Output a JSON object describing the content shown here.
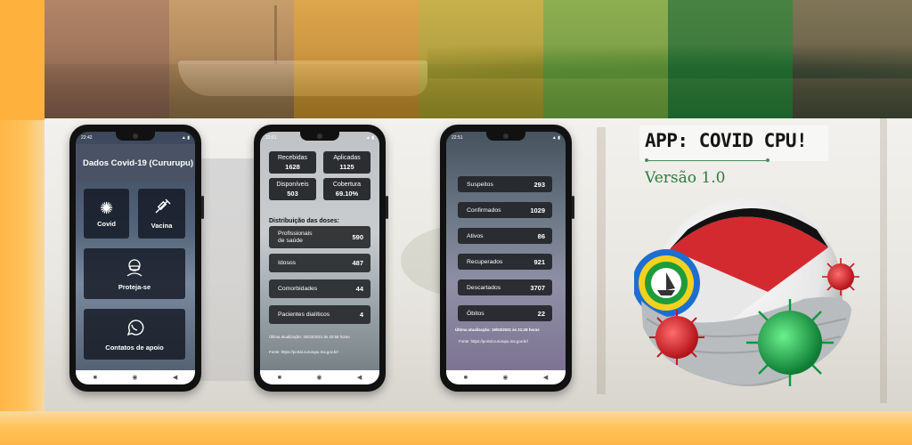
{
  "banner": {
    "colors": [
      "#a06e5a",
      "#c8965a",
      "#f0aa28",
      "#c8be28",
      "#6eb43c",
      "#1e7832",
      "#46503c"
    ]
  },
  "title": {
    "app_name": "APP: COVID CPU!",
    "version": "Versão 1.0"
  },
  "phone1": {
    "status_time": "22:42",
    "header": "Dados Covid-19 (Cururupu)",
    "cards": [
      {
        "label": "Covid",
        "icon": "virus-icon"
      },
      {
        "label": "Vacina",
        "icon": "syringe-icon"
      },
      {
        "label": "Proteja-se",
        "icon": "masked-face-icon"
      },
      {
        "label": "Contatos de apoio",
        "icon": "whatsapp-icon"
      }
    ]
  },
  "phone2": {
    "status_time": "22:51",
    "stats": [
      {
        "label": "Recebidas",
        "value": "1628"
      },
      {
        "label": "Aplicadas",
        "value": "1125"
      },
      {
        "label": "Disponíveis",
        "value": "503"
      },
      {
        "label": "Cobertura",
        "value": "69.10%"
      }
    ],
    "distribution_title": "Distribuição das doses:",
    "doses": [
      {
        "label_line1": "Profissionais",
        "label_line2": "de saúde",
        "value": "590"
      },
      {
        "label": "Idosos",
        "value": "487"
      },
      {
        "label": "Comorbidades",
        "value": "44"
      },
      {
        "label": "Pacientes dialíticos",
        "value": "4"
      }
    ],
    "last_update": "Última atualização: 20/03/2021 às 22:58 horas",
    "source": "Fonte: https://portal.cururupu.ma.gov.br/"
  },
  "phone3": {
    "status_time": "22:51",
    "cases": [
      {
        "label": "Suspeitos",
        "value": "293"
      },
      {
        "label": "Confirmados",
        "value": "1029"
      },
      {
        "label": "Ativos",
        "value": "86"
      },
      {
        "label": "Recuperados",
        "value": "921"
      },
      {
        "label": "Descartados",
        "value": "3707"
      },
      {
        "label": "Óbitos",
        "value": "22"
      }
    ],
    "last_update": "Última atualização: 19/03/2021 às 21:28 horas",
    "source": "Fonte: https://portal.cururupu.ma.gov.br/"
  },
  "navbar": {
    "square": "■",
    "circle": "◉",
    "back": "◀"
  },
  "colors": {
    "virus_red": "#d9232a",
    "virus_green": "#1fa84a",
    "flag_red": "#d32a30",
    "flag_black": "#111111"
  }
}
